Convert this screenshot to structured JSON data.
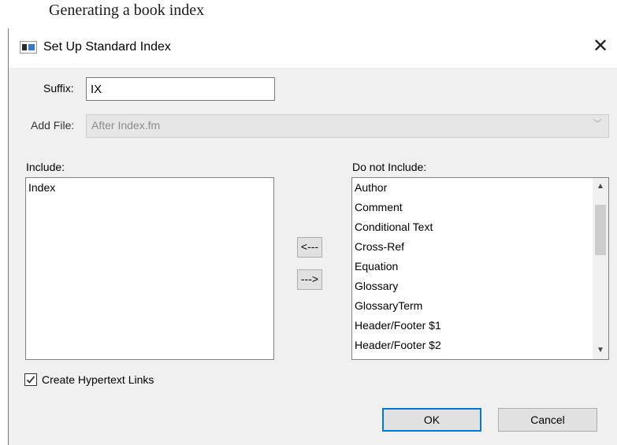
{
  "caption": "Generating a book index",
  "window": {
    "title": "Set Up Standard Index",
    "icon": "app-window-icon",
    "close_glyph": "✕"
  },
  "suffix": {
    "label": "Suffix:",
    "value": "IX"
  },
  "add_file": {
    "label": "Add File:",
    "value": "After Index.fm",
    "chevron": "﹀"
  },
  "include": {
    "label": "Include:",
    "items": [
      "Index"
    ]
  },
  "do_not_include": {
    "label": "Do not Include:",
    "items": [
      "Author",
      "Comment",
      "Conditional Text",
      "Cross-Ref",
      "Equation",
      "Glossary",
      "GlossaryTerm",
      "Header/Footer $1",
      "Header/Footer $2"
    ],
    "scroll_up": "▲",
    "scroll_down": "▼"
  },
  "move_left_label": "<---",
  "move_right_label": "--->",
  "hypertext": {
    "label": "Create Hypertext Links",
    "checked": true
  },
  "ok_label": "OK",
  "cancel_label": "Cancel",
  "colors": {
    "accent": "#0078d7",
    "client_bg": "#f0f0f0",
    "disabled_text": "#8c8c8c"
  }
}
